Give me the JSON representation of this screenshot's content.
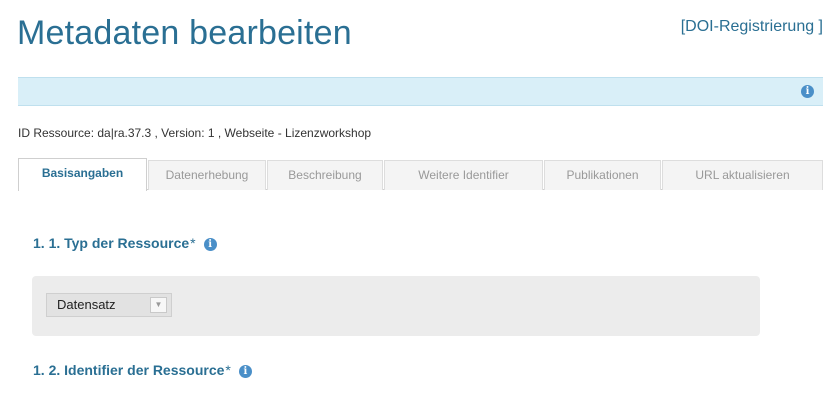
{
  "page": {
    "title": "Metadaten bearbeiten",
    "doi_link": "[DOI-Registrierung ]"
  },
  "info_bar": {
    "icon": "info-icon"
  },
  "resource_id": "ID Ressource: da|ra.37.3 , Version: 1 , Webseite - Lizenzworkshop",
  "tabs": [
    {
      "label": "Basisangaben",
      "active": true
    },
    {
      "label": "Datenerhebung",
      "active": false
    },
    {
      "label": "Beschreibung",
      "active": false
    },
    {
      "label": "Weitere Identifier",
      "active": false
    },
    {
      "label": "Publikationen",
      "active": false
    },
    {
      "label": "URL aktualisieren",
      "active": false
    }
  ],
  "sections": [
    {
      "heading": "1. 1. Typ der Ressource",
      "required_mark": "*"
    },
    {
      "heading": "1. 2. Identifier der Ressource",
      "required_mark": "*"
    }
  ],
  "resource_type_select": {
    "value": "Datensatz",
    "arrow_icon": "chevron-down-icon"
  },
  "colors": {
    "accent": "#2a6f93",
    "info_bar": "#d9eff8",
    "info_icon": "#4a8fc8",
    "field_bg": "#ececec"
  }
}
